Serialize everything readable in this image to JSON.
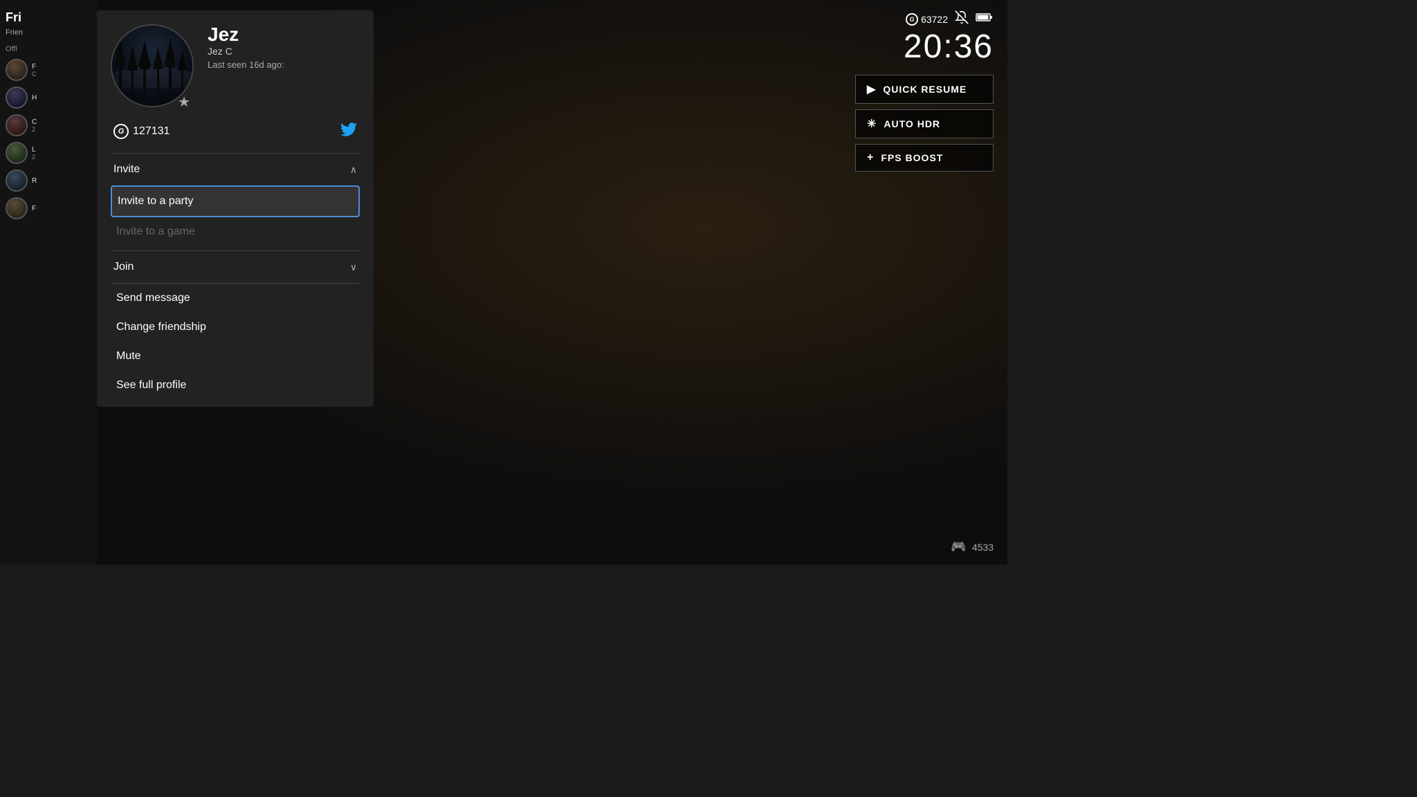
{
  "background": {
    "color": "#0d0d0d"
  },
  "friends_panel": {
    "title": "Fri",
    "subtitle": "Frien",
    "status_offline": "Offl",
    "status_friends": "F",
    "friends": [
      {
        "name": "F",
        "detail": "C",
        "avatar_class": "avatar-fill-1",
        "border": "gray"
      },
      {
        "name": "H",
        "detail": "",
        "avatar_class": "avatar-fill-2",
        "border": "gray"
      },
      {
        "name": "C",
        "detail": "2",
        "avatar_class": "avatar-fill-3",
        "border": "gray"
      },
      {
        "name": "L",
        "detail": "2",
        "avatar_class": "avatar-fill-4",
        "border": "gray"
      },
      {
        "name": "R",
        "detail": "",
        "avatar_class": "avatar-fill-5",
        "border": "gray"
      },
      {
        "name": "F",
        "detail": "",
        "avatar_class": "avatar-fill-6",
        "border": "gray"
      }
    ]
  },
  "profile": {
    "name": "Jez",
    "gamertag": "Jez C",
    "last_seen": "Last seen 16d ago:",
    "gamerscore": "127131",
    "gamerscore_label": "G",
    "twitter_symbol": "🐦"
  },
  "menu": {
    "invite_section": {
      "label": "Invite",
      "chevron_up": "∧",
      "items": [
        {
          "label": "Invite to a party",
          "selected": true,
          "disabled": false
        },
        {
          "label": "Invite to a game",
          "selected": false,
          "disabled": true
        }
      ]
    },
    "join_section": {
      "label": "Join",
      "chevron_down": "∨",
      "collapsed": true
    },
    "other_items": [
      {
        "label": "Send message",
        "disabled": false
      },
      {
        "label": "Change friendship",
        "disabled": false
      },
      {
        "label": "Mute",
        "disabled": false
      },
      {
        "label": "See full profile",
        "disabled": false
      }
    ]
  },
  "hud": {
    "gamerscore": "63722",
    "gamerscore_label": "G",
    "time": "20:36",
    "quick_resume_label": "QUICK RESUME",
    "auto_hdr_label": "AUTO HDR",
    "fps_boost_label": "FPS BOOST",
    "controller_score": "4533"
  }
}
